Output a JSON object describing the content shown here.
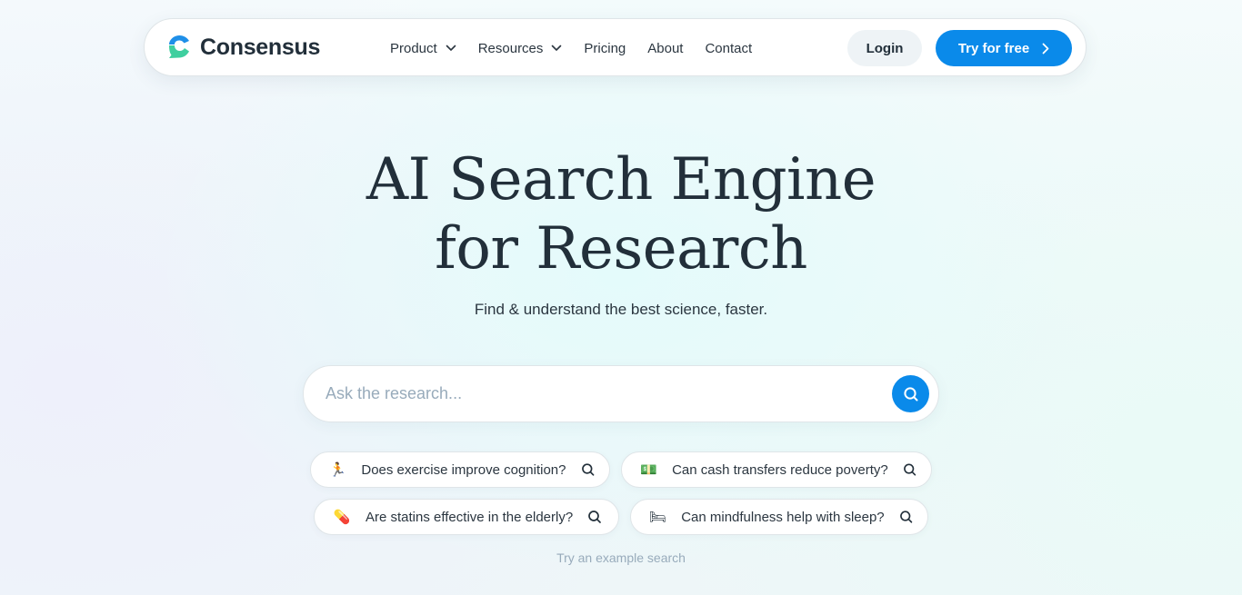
{
  "brand": {
    "name": "Consensus",
    "colors": {
      "primary": "#0a8aea",
      "logo_blue": "#1f8fe8",
      "logo_green": "#3fcf9f",
      "text": "#222f3a"
    }
  },
  "nav": {
    "links": [
      {
        "label": "Product",
        "has_dropdown": true
      },
      {
        "label": "Resources",
        "has_dropdown": true
      },
      {
        "label": "Pricing",
        "has_dropdown": false
      },
      {
        "label": "About",
        "has_dropdown": false
      },
      {
        "label": "Contact",
        "has_dropdown": false
      }
    ],
    "login_label": "Login",
    "cta_label": "Try for free"
  },
  "hero": {
    "title_line1": "AI Search Engine",
    "title_line2": "for Research",
    "subtitle": "Find & understand the best science, faster."
  },
  "search": {
    "placeholder": "Ask the research...",
    "value": "",
    "button_icon": "search-icon"
  },
  "examples": {
    "items": [
      {
        "emoji": "🏃",
        "icon": "runner-icon",
        "label": "Does exercise improve cognition?"
      },
      {
        "emoji": "💵",
        "icon": "money-icon",
        "label": "Can cash transfers reduce poverty?"
      },
      {
        "emoji": "💊",
        "icon": "pill-icon",
        "label": "Are statins effective in the elderly?"
      },
      {
        "emoji": "🛏",
        "icon": "bed-icon",
        "label": "Can mindfulness help with sleep?"
      }
    ],
    "caption": "Try an example search"
  }
}
